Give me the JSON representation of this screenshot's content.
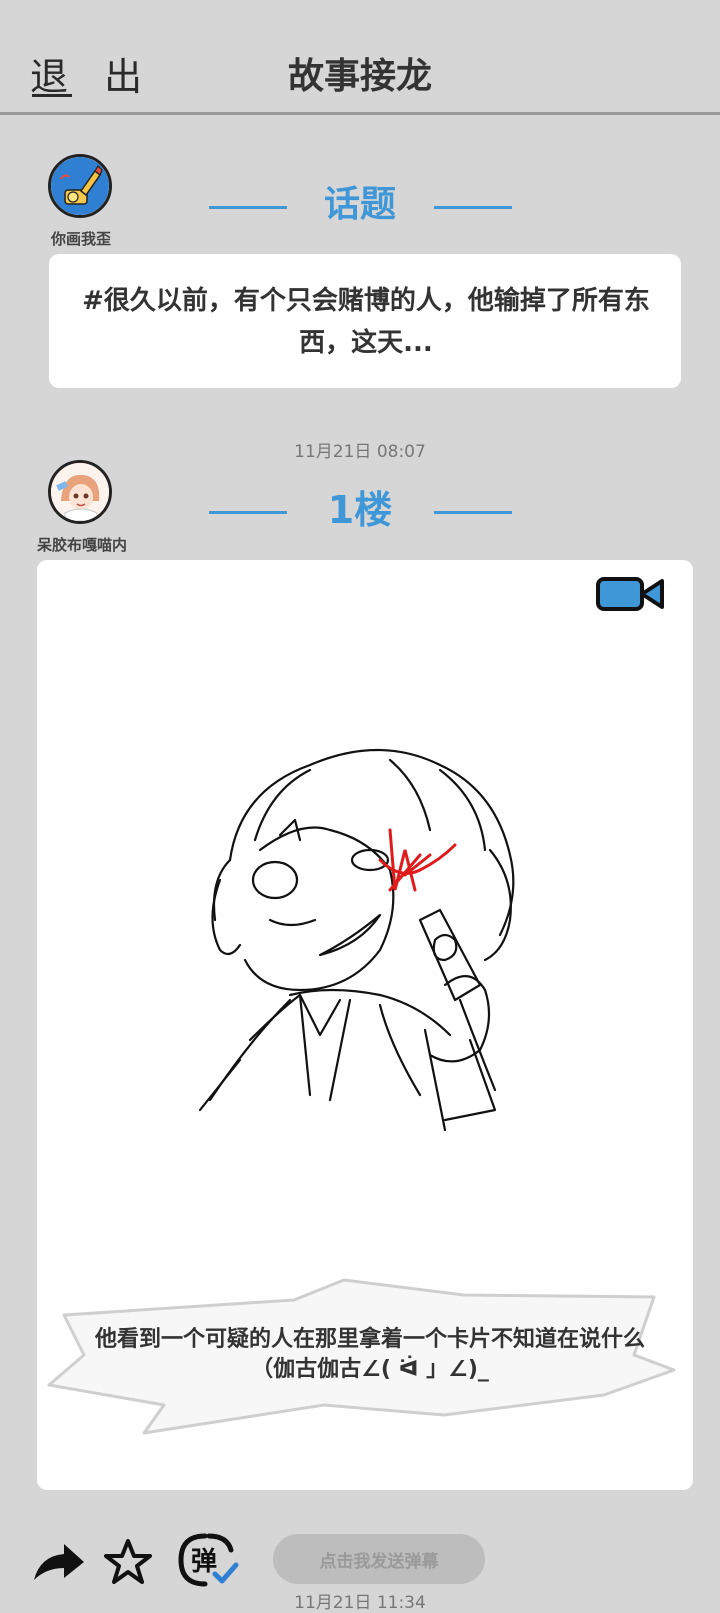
{
  "header": {
    "exit_label": "退 出",
    "title": "故事接龙"
  },
  "topic": {
    "author": "你画我歪",
    "section_label": "话题",
    "text": "#很久以前，有个只会赌博的人，他输掉了所有东西，这天..."
  },
  "floor1": {
    "timestamp": "11月21日 08:07",
    "author": "呆胶布嘎喵内",
    "section_label": "1楼",
    "caption": "他看到一个可疑的人在那里拿着一个卡片不知道在说什么（伽古伽古∠( ᐛ 」∠)_"
  },
  "actions": {
    "share_icon": "share-arrow-icon",
    "favorite_icon": "star-icon",
    "danmaku_icon": "danmaku-toggle-icon",
    "danmaku_placeholder": "点击我发送弹幕",
    "next_timestamp": "11月21日 11:34"
  },
  "colors": {
    "background": "#d6d6d6",
    "accent": "#3f97d8",
    "card": "#ffffff"
  }
}
